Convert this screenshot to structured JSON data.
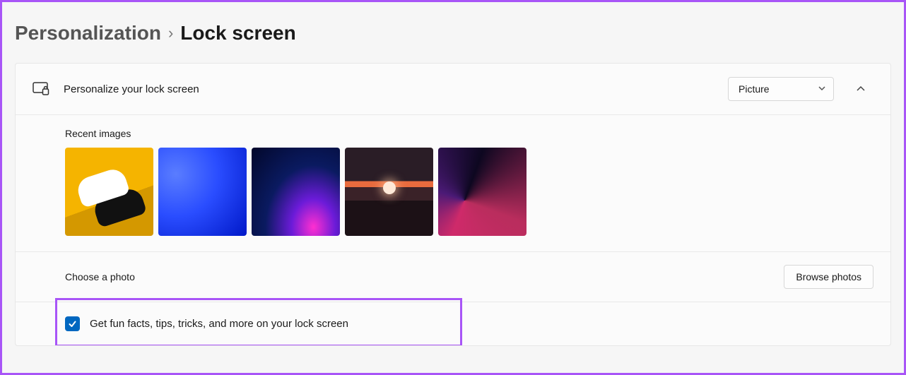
{
  "breadcrumb": {
    "parent": "Personalization",
    "separator": "›",
    "current": "Lock screen"
  },
  "section": {
    "title": "Personalize your lock screen",
    "dropdown": {
      "selected": "Picture"
    }
  },
  "recent": {
    "label": "Recent images",
    "count": 5
  },
  "choose": {
    "label": "Choose a photo",
    "button": "Browse photos"
  },
  "funfacts": {
    "checked": true,
    "label": "Get fun facts, tips, tricks, and more on your lock screen"
  }
}
